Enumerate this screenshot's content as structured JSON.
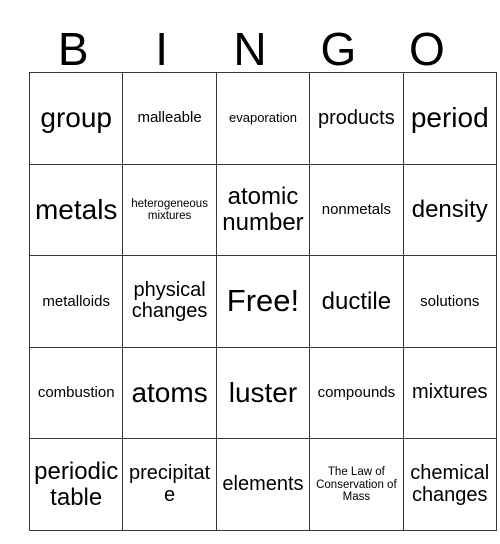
{
  "card": {
    "title": "BINGO",
    "header_letters": [
      "B",
      "I",
      "N",
      "G",
      "O"
    ],
    "free_space_label": "Free!",
    "border_color": "#3a3a3a",
    "background_color": "#ffffff",
    "text_color": "#000000",
    "columns": 5,
    "rows": 5,
    "rows_data": [
      [
        {
          "text": "group",
          "size": "xl"
        },
        {
          "text": "malleable",
          "size": "s"
        },
        {
          "text": "evaporation",
          "size": "xs"
        },
        {
          "text": "products",
          "size": "m"
        },
        {
          "text": "period",
          "size": "xl"
        }
      ],
      [
        {
          "text": "metals",
          "size": "xl"
        },
        {
          "text": "heterogeneous mixtures",
          "size": "xxs"
        },
        {
          "text": "atomic number",
          "size": "l"
        },
        {
          "text": "nonmetals",
          "size": "s"
        },
        {
          "text": "density",
          "size": "l"
        }
      ],
      [
        {
          "text": "metalloids",
          "size": "s"
        },
        {
          "text": "physical changes",
          "size": "m"
        },
        {
          "text": "Free!",
          "size": "xxl"
        },
        {
          "text": "ductile",
          "size": "l"
        },
        {
          "text": "solutions",
          "size": "s"
        }
      ],
      [
        {
          "text": "combustion",
          "size": "s"
        },
        {
          "text": "atoms",
          "size": "xl"
        },
        {
          "text": "luster",
          "size": "xl"
        },
        {
          "text": "compounds",
          "size": "s"
        },
        {
          "text": "mixtures",
          "size": "m"
        }
      ],
      [
        {
          "text": "periodic table",
          "size": "l"
        },
        {
          "text": "precipitate",
          "size": "m"
        },
        {
          "text": "elements",
          "size": "m"
        },
        {
          "text": "The Law of Conservation of Mass",
          "size": "xxs"
        },
        {
          "text": "chemical changes",
          "size": "m"
        }
      ]
    ]
  }
}
